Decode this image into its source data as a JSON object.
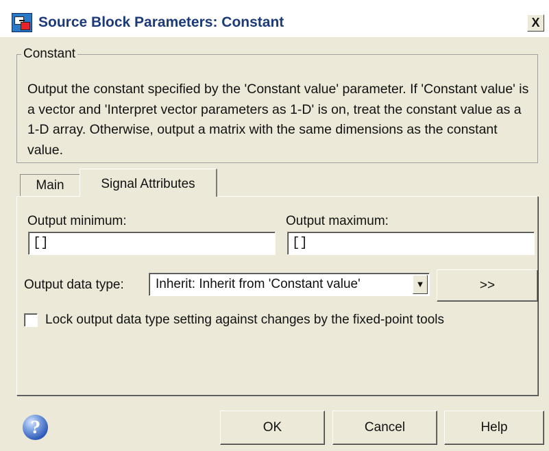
{
  "window": {
    "title": "Source Block Parameters: Constant",
    "close_glyph": "X"
  },
  "group": {
    "legend": "Constant",
    "description": "Output the constant specified by the 'Constant value' parameter. If 'Constant value' is a vector and 'Interpret vector parameters as 1-D' is on, treat the constant value as a 1-D array. Otherwise, output a matrix with the same dimensions as the constant value."
  },
  "tabs": [
    {
      "label": "Main",
      "selected": false
    },
    {
      "label": "Signal Attributes",
      "selected": true
    }
  ],
  "signal_attributes": {
    "output_minimum_label": "Output minimum:",
    "output_minimum_value": "[]",
    "output_maximum_label": "Output maximum:",
    "output_maximum_value": "[]",
    "output_data_type_label": "Output data type:",
    "output_data_type_value": "Inherit: Inherit from 'Constant value'",
    "show_assistant_label": ">>",
    "lock_checkbox_label": "Lock output data type setting against changes by the fixed-point tools",
    "lock_checked": false
  },
  "footer": {
    "help_icon_glyph": "?",
    "ok_label": "OK",
    "cancel_label": "Cancel",
    "help_label": "Help"
  },
  "icons": [
    "simulink-block-icon",
    "close-icon",
    "dropdown-arrow-icon",
    "help-circle-icon"
  ]
}
